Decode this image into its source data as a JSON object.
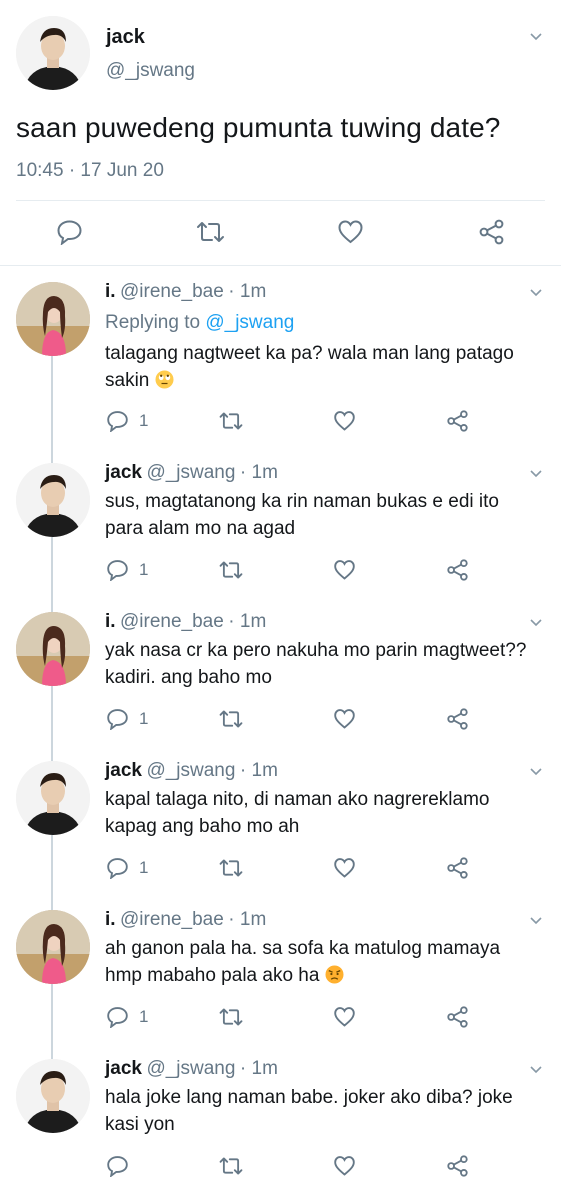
{
  "main_tweet": {
    "name": "jack",
    "handle": "@_jswang",
    "text": "saan puwedeng pumunta tuwing date?",
    "timestamp": "10:45 · 17 Jun 20"
  },
  "replies": [
    {
      "name": "i.",
      "handle": "@irene_bae",
      "time": "· 1m",
      "replying_prefix": "Replying to",
      "replying_handle": "@_jswang",
      "line1": "talagang nagtweet ka pa? wala man lang patago",
      "line2": "sakin",
      "emoji": "rolling-eyes",
      "reply_count": "1"
    },
    {
      "name": "jack",
      "handle": "@_jswang",
      "time": "· 1m",
      "line1": "sus, magtatanong ka rin naman bukas e edi ito",
      "line2": "para alam mo na agad",
      "reply_count": "1"
    },
    {
      "name": "i.",
      "handle": "@irene_bae",
      "time": "· 1m",
      "line1": "yak nasa cr ka pero nakuha mo parin magtweet??",
      "line2": "kadiri. ang baho mo",
      "reply_count": "1"
    },
    {
      "name": "jack",
      "handle": "@_jswang",
      "time": "· 1m",
      "line1": "kapal talaga nito, di naman ako nagrereklamo",
      "line2": "kapag ang baho mo ah",
      "reply_count": "1"
    },
    {
      "name": "i.",
      "handle": "@irene_bae",
      "time": "· 1m",
      "line1": "ah ganon pala ha. sa sofa ka matulog mamaya",
      "line2": "hmp mabaho pala ako ha",
      "emoji": "angry-face",
      "reply_count": "1"
    },
    {
      "name": "jack",
      "handle": "@_jswang",
      "time": "· 1m",
      "line1": "hala joke lang naman babe. joker ako diba? joke",
      "line2": "kasi yon",
      "reply_count": ""
    }
  ],
  "colors": {
    "text": "#14171a",
    "muted": "#657786",
    "link": "#1da1f2",
    "divider": "#e6ecf0",
    "thread_line": "#ccd6dd"
  },
  "icons": [
    "reply-icon",
    "retweet-icon",
    "like-icon",
    "share-icon",
    "chevron-down-icon"
  ]
}
